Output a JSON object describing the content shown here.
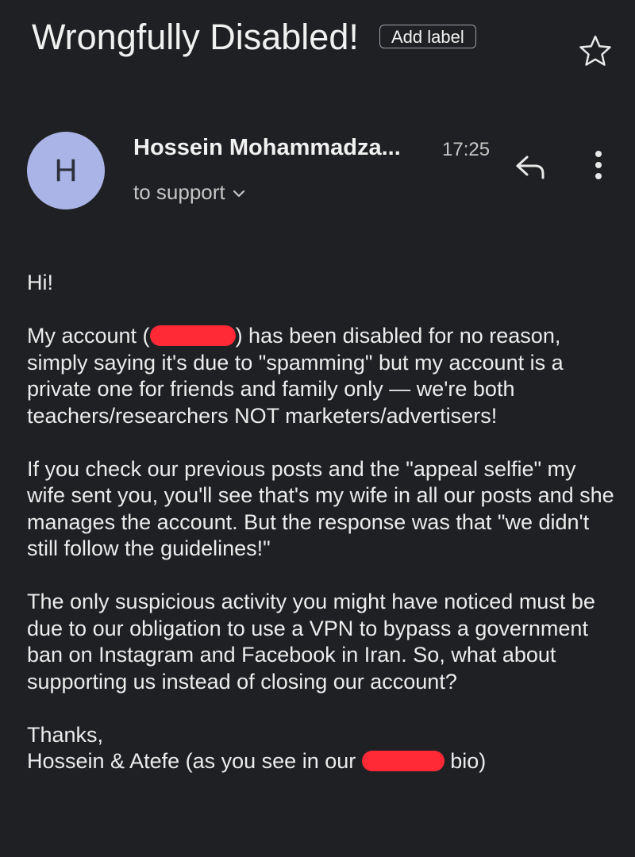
{
  "email": {
    "subject": "Wrongfully Disabled!",
    "add_label": "Add label",
    "sender": {
      "initial": "H",
      "name": "Hossein Mohammadza...",
      "time": "17:25",
      "recipient_label": "to support"
    },
    "body": {
      "greeting": "Hi!",
      "p1_before": "My account (",
      "p1_after": ") has been disabled for no reason, simply saying it's due to \"spamming\" but my account is a private one for friends and family only — we're both teachers/researchers NOT marketers/advertisers!",
      "p2": "If you check our previous posts and the \"appeal selfie\" my wife sent you, you'll see that's my wife in all our posts and she manages the account. But the response was that \"we didn't still follow the guidelines!\"",
      "p3": "The only suspicious activity you might have noticed must be due to our obligation to use a VPN to bypass a government ban on Instagram and Facebook in Iran. So, what about supporting us instead of closing our account?",
      "closing": "Thanks,",
      "signature_before": "Hossein & Atefe (as you see in our ",
      "signature_after": " bio)"
    }
  },
  "icons": {
    "star": "star-outline-icon",
    "reply": "reply-icon",
    "more": "more-vertical-icon",
    "expand": "chevron-down-icon"
  },
  "colors": {
    "background": "#1f2023",
    "avatar": "#aab4e6",
    "redaction": "#ff2a36"
  }
}
